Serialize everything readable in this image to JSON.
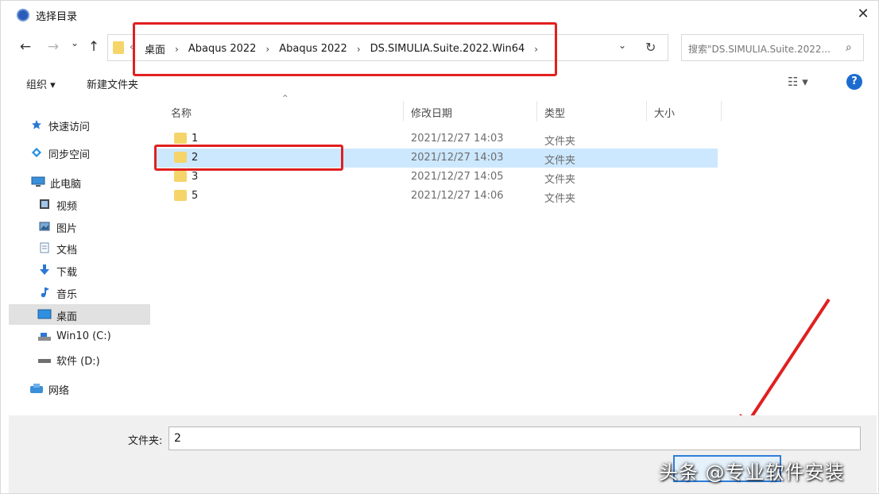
{
  "window": {
    "title": "选择目录",
    "close_glyph": "✕"
  },
  "nav": {
    "back_glyph": "←",
    "forward_glyph": "→",
    "dropdown_glyph": "⌄",
    "up_glyph": "↑",
    "refresh_glyph": "↻",
    "breadcrumbs": [
      "桌面",
      "Abaqus 2022",
      "Abaqus 2022",
      "DS.SIMULIA.Suite.2022.Win64"
    ],
    "crumb_sep": "›",
    "search_placeholder": "搜索\"DS.SIMULIA.Suite.2022..."
  },
  "toolbar": {
    "organize": "组织 ▾",
    "new_folder": "新建文件夹",
    "view_glyph": "☷ ▾",
    "help_glyph": "?"
  },
  "sidebar": {
    "items": [
      {
        "label": "快速访问",
        "icon": "star-icon"
      },
      {
        "label": "同步空间",
        "icon": "sync-icon"
      },
      {
        "label": "此电脑",
        "icon": "computer-icon"
      },
      {
        "label": "视频",
        "icon": "video-icon"
      },
      {
        "label": "图片",
        "icon": "picture-icon"
      },
      {
        "label": "文档",
        "icon": "document-icon"
      },
      {
        "label": "下载",
        "icon": "download-icon"
      },
      {
        "label": "音乐",
        "icon": "music-icon"
      },
      {
        "label": "桌面",
        "icon": "desktop-icon"
      },
      {
        "label": "Win10 (C:)",
        "icon": "drive-icon"
      },
      {
        "label": "软件 (D:)",
        "icon": "drive-icon"
      },
      {
        "label": "网络",
        "icon": "network-icon"
      }
    ],
    "active_index": 8
  },
  "list": {
    "columns": [
      "名称",
      "修改日期",
      "类型",
      "大小"
    ],
    "rows": [
      {
        "name": "1",
        "date": "2021/12/27 14:03",
        "type": "文件夹"
      },
      {
        "name": "2",
        "date": "2021/12/27 14:03",
        "type": "文件夹"
      },
      {
        "name": "3",
        "date": "2021/12/27 14:05",
        "type": "文件夹"
      },
      {
        "name": "5",
        "date": "2021/12/27 14:06",
        "type": "文件夹"
      }
    ],
    "selected_index": 1
  },
  "footer": {
    "folder_label": "文件夹:",
    "folder_value": "2"
  },
  "watermark": "头条 @专业软件安装",
  "colors": {
    "selection": "#cce8ff",
    "annotation_red": "#e02020",
    "accent": "#1c6cd0"
  }
}
